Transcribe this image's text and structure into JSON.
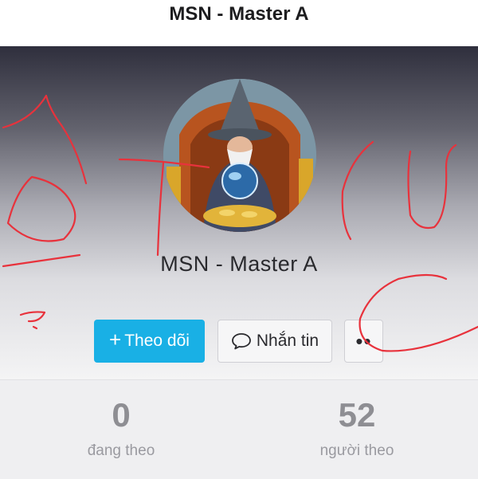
{
  "header": {
    "title": "MSN - Master A"
  },
  "profile": {
    "name": "MSN - Master A",
    "avatar_icon": "wizard-avatar"
  },
  "actions": {
    "follow_plus": "+",
    "follow_label": "Theo dõi",
    "message_label": "Nhắn tin",
    "message_icon": "chat-bubble-icon",
    "more_label": "••",
    "follow_color": "#19b0e5"
  },
  "stats": {
    "following": {
      "value": "0",
      "label": "đang theo"
    },
    "followers": {
      "value": "52",
      "label": "người theo"
    }
  },
  "colors": {
    "scribble": "#e8323c"
  }
}
